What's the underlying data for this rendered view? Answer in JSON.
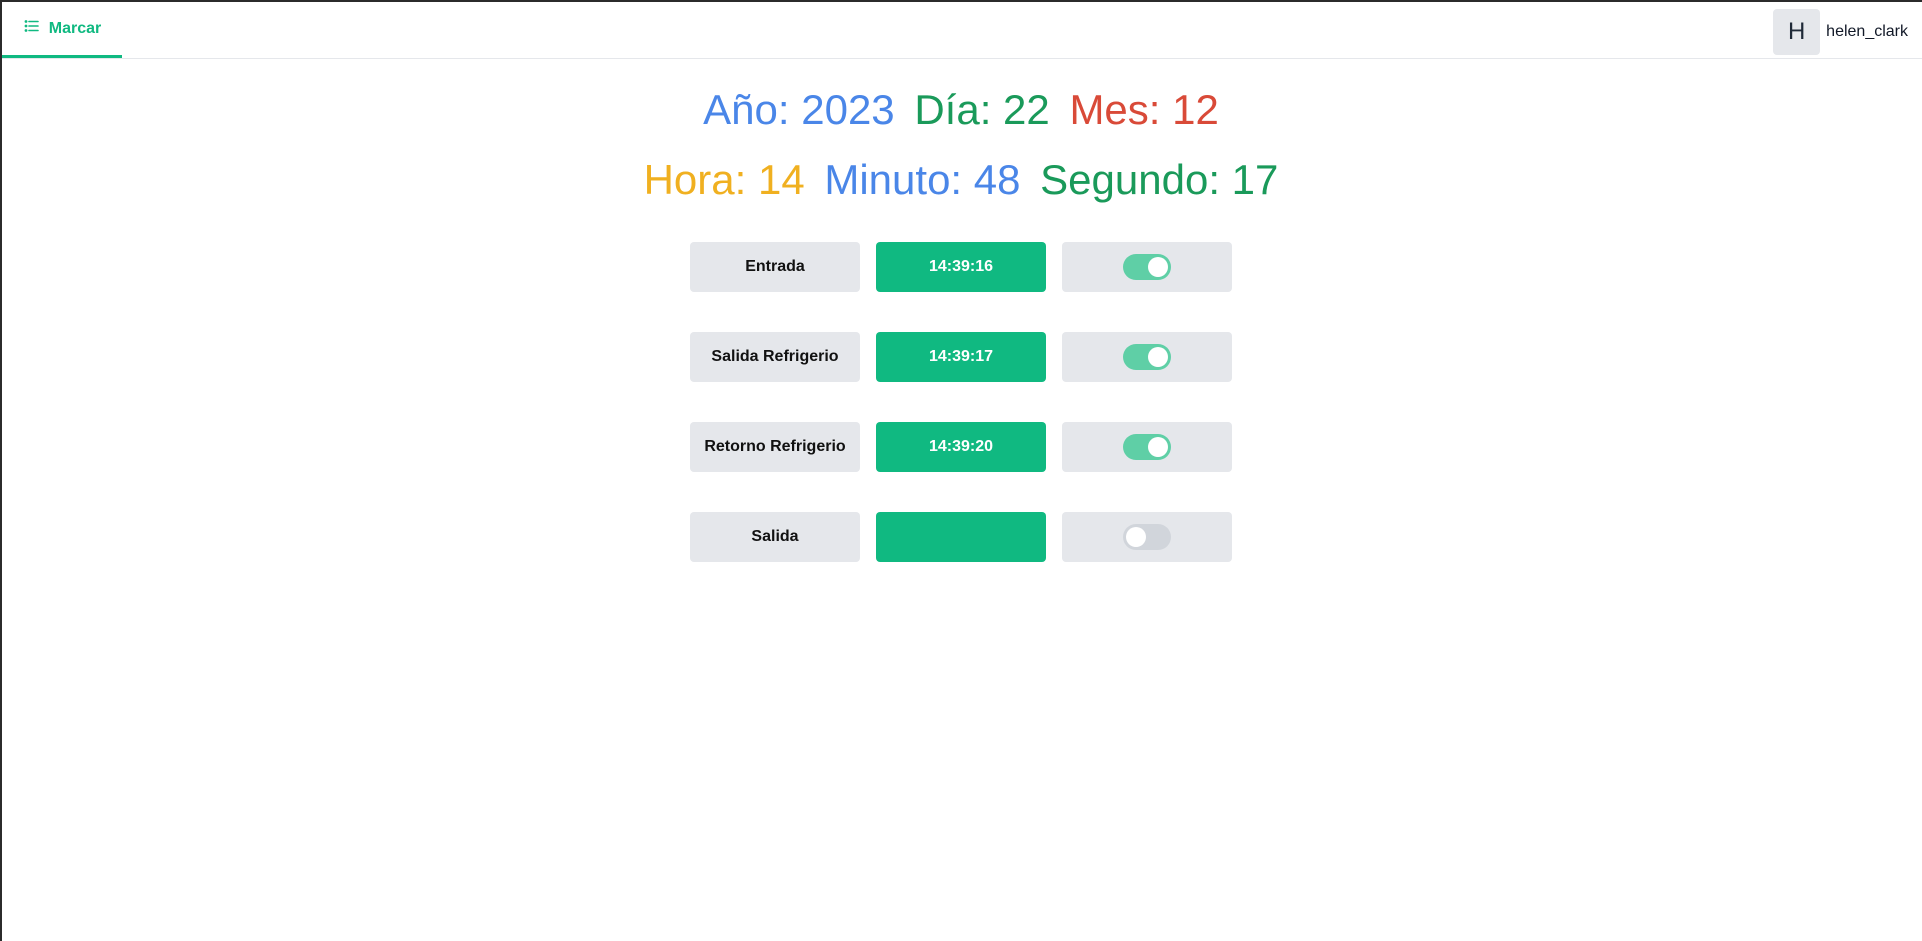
{
  "nav": {
    "tab_label": "Marcar",
    "tab_icon": "list-icon"
  },
  "user": {
    "avatar_initial": "H",
    "username": "helen_clark"
  },
  "date": {
    "year_label": "Año:",
    "year_value": "2023",
    "day_label": "Día:",
    "day_value": "22",
    "month_label": "Mes:",
    "month_value": "12"
  },
  "time": {
    "hour_label": "Hora:",
    "hour_value": "14",
    "minute_label": "Minuto:",
    "minute_value": "48",
    "second_label": "Segundo:",
    "second_value": "17"
  },
  "colors": {
    "accent": "#10b981",
    "blue": "#4a86e8",
    "green": "#1a9a5a",
    "red": "#d94a38",
    "yellow": "#f0b020"
  },
  "marks": [
    {
      "label": "Entrada",
      "time": "14:39:16",
      "enabled": true
    },
    {
      "label": "Salida Refrigerio",
      "time": "14:39:17",
      "enabled": true
    },
    {
      "label": "Retorno Refrigerio",
      "time": "14:39:20",
      "enabled": true
    },
    {
      "label": "Salida",
      "time": "",
      "enabled": false
    }
  ]
}
